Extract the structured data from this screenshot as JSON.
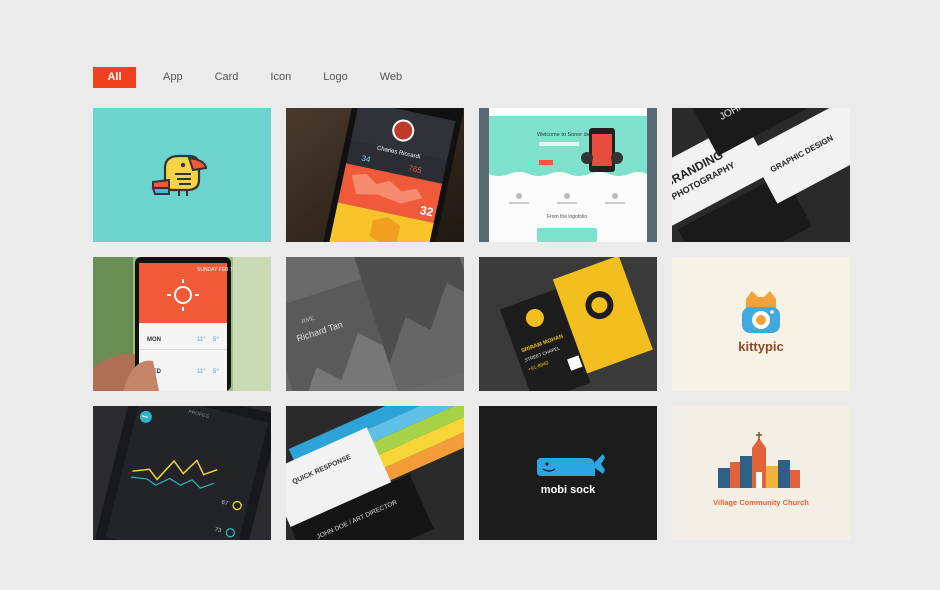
{
  "filters": {
    "all": "All",
    "app": "App",
    "card": "Card",
    "icon": "Icon",
    "logo": "Logo",
    "web": "Web",
    "active": "All"
  },
  "colors": {
    "accent": "#f0401c",
    "background": "#ebebeb"
  },
  "portfolio": {
    "tile1": {
      "category": "Logo",
      "icon": "toucan-logo"
    },
    "tile2": {
      "category": "App",
      "profile_name": "Charles Riccardi",
      "stat1": "34",
      "stat2": "765",
      "stat3": "32"
    },
    "tile3": {
      "category": "Web",
      "headline": "Welcome to Sonor design",
      "section": "From the logofolio"
    },
    "tile4": {
      "category": "Card",
      "text1": "BRANDING",
      "text2": "PHOTOGRAPHY",
      "text3": "GRAPHIC DESIGN",
      "text4": "JOHN DOE"
    },
    "tile5": {
      "category": "App",
      "top_label": "SUNDAY FEB 7",
      "day1": "MON",
      "day2": "WED",
      "temp1": "11°",
      "temp2": "5°",
      "temp3": "11°",
      "temp4": "5°"
    },
    "tile6": {
      "category": "Card",
      "name": "Richard Tan",
      "brand": "RME"
    },
    "tile7": {
      "category": "Card",
      "name": "SRIRAM MOHAN",
      "sub": "STREET CHAPEL",
      "num": "+91-8940"
    },
    "tile8": {
      "category": "Logo",
      "wordmark": "kittypic"
    },
    "tile9": {
      "category": "App",
      "header": "PROFILE",
      "v1": "67",
      "v2": "73"
    },
    "tile10": {
      "category": "Card",
      "title": "QUICK RESPONSE",
      "name": "JOHN DOE / ART DIRECTOR"
    },
    "tile11": {
      "category": "Logo",
      "wordmark": "mobi sock"
    },
    "tile12": {
      "category": "Logo",
      "wordmark": "Village Community Church"
    }
  }
}
